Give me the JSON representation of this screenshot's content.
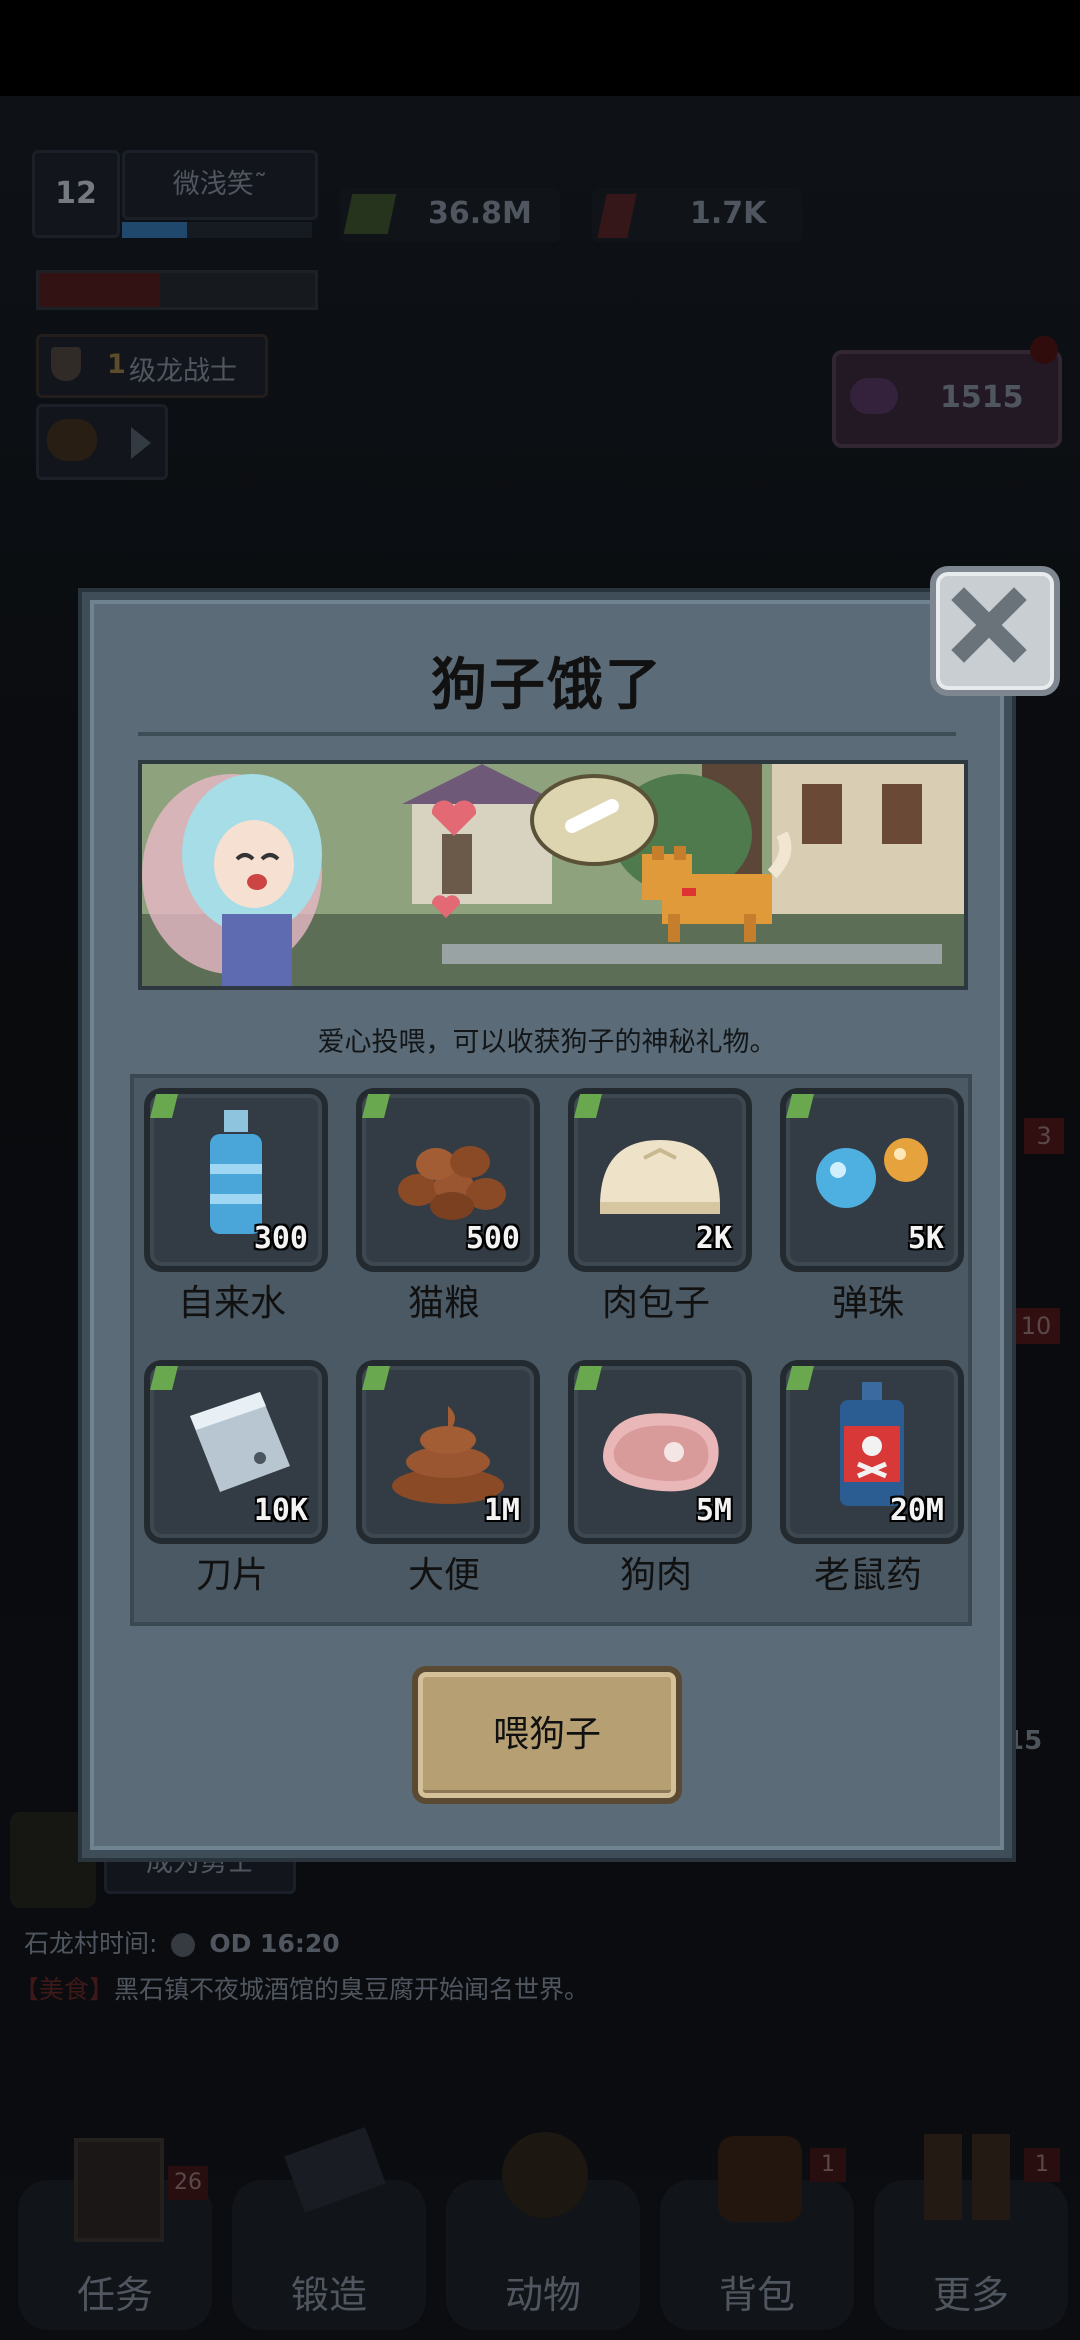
{
  "hud": {
    "level": "12",
    "player_name": "微浅笑˜",
    "currency_green": "36.8M",
    "currency_red": "1.7K",
    "rank_num": "1",
    "rank_title": "级龙战士",
    "gems": "1515"
  },
  "background": {
    "quest_text": "成为勇士",
    "village_time_label": "石龙村时间:",
    "village_time": "OD 16:20",
    "news_tag": "【美食】",
    "news_text": "黑石镇不夜城酒馆的臭豆腐开始闻名世界。",
    "side_badges": [
      "3",
      "10",
      "15"
    ]
  },
  "bottom_nav": [
    {
      "label": "任务",
      "badge": "26"
    },
    {
      "label": "锻造",
      "badge": ""
    },
    {
      "label": "动物",
      "badge": ""
    },
    {
      "label": "背包",
      "badge": "1"
    },
    {
      "label": "更多",
      "badge": "1"
    }
  ],
  "modal": {
    "title": "狗子饿了",
    "subtitle": "爱心投喂，可以收获狗子的神秘礼物。",
    "feed_button": "喂狗子",
    "items": [
      {
        "name": "自来水",
        "price": "300",
        "icon": "water-bottle-icon"
      },
      {
        "name": "猫粮",
        "price": "500",
        "icon": "cat-food-icon"
      },
      {
        "name": "肉包子",
        "price": "2K",
        "icon": "meat-bun-icon"
      },
      {
        "name": "弹珠",
        "price": "5K",
        "icon": "marbles-icon"
      },
      {
        "name": "刀片",
        "price": "10K",
        "icon": "blade-icon"
      },
      {
        "name": "大便",
        "price": "1M",
        "icon": "poop-icon"
      },
      {
        "name": "狗肉",
        "price": "5M",
        "icon": "dog-meat-icon"
      },
      {
        "name": "老鼠药",
        "price": "20M",
        "icon": "rat-poison-icon"
      }
    ]
  },
  "colors": {
    "modal_bg": "#5b6c78",
    "button_gold": "#b79f74",
    "currency_green": "#6aa84f"
  }
}
